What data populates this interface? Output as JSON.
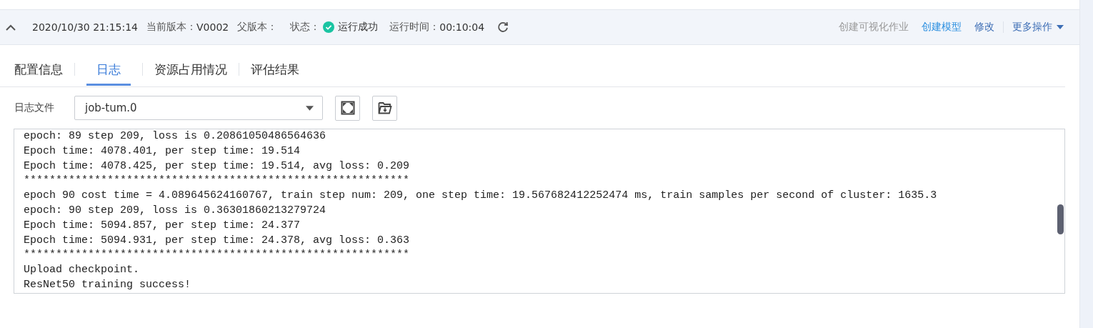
{
  "header": {
    "expanded": true,
    "timestamp": "2020/10/30 21:15:14",
    "fields": [
      {
        "label": "当前版本：",
        "value": "V0002"
      },
      {
        "label": "父版本："
      }
    ],
    "status": {
      "label": "状态：",
      "value": "运行成功",
      "kind": "success"
    },
    "runtime": {
      "label": "运行时间：",
      "value": "00:10:04"
    },
    "actions": [
      {
        "label": "创建可视化作业",
        "kind": "link",
        "disabled": true
      },
      {
        "label": "创建模型",
        "kind": "link",
        "disabled": false
      },
      {
        "label": "修改",
        "kind": "link",
        "disabled": false
      },
      {
        "label": "更多操作",
        "kind": "dropdown",
        "disabled": false
      }
    ]
  },
  "tabs": [
    {
      "label": "配置信息",
      "selected": false
    },
    {
      "label": "日志",
      "selected": true
    },
    {
      "label": "资源占用情况",
      "selected": false
    },
    {
      "label": "评估结果",
      "selected": false
    }
  ],
  "log_file": {
    "label": "日志文件",
    "value": "job-tum.0"
  },
  "log_lines": [
    "epoch: 89 step 209, loss is 0.20861050486564636",
    "Epoch time: 4078.401, per step time: 19.514",
    "Epoch time: 4078.425, per step time: 19.514, avg loss: 0.209",
    "************************************************************",
    "epoch 90 cost time = 4.089645624160767, train step num: 209, one step time: 19.567682412252474 ms, train samples per second of cluster: 1635.3",
    "epoch: 90 step 209, loss is 0.36301860213279724",
    "Epoch time: 5094.857, per step time: 24.377",
    "Epoch time: 5094.931, per step time: 24.378, avg loss: 0.363",
    "************************************************************",
    "Upload checkpoint.",
    "ResNet50 training success!"
  ]
}
